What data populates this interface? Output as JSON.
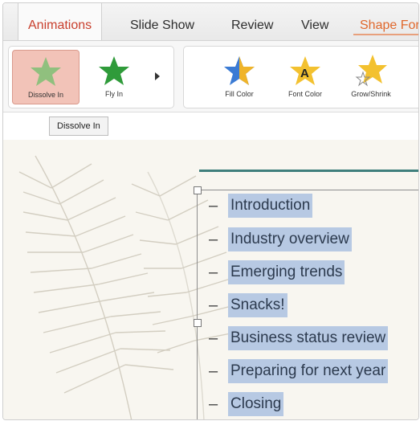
{
  "tabs": [
    {
      "label": "Animations",
      "active": true
    },
    {
      "label": "Slide Show"
    },
    {
      "label": "Review"
    },
    {
      "label": "View"
    },
    {
      "label": "Shape For"
    }
  ],
  "ribbon": {
    "effects": [
      {
        "label": "Dissolve In",
        "icon": "star-dissolve-icon",
        "selected": true
      },
      {
        "label": "Fly In",
        "icon": "star-fly-icon"
      }
    ],
    "emphasis": [
      {
        "label": "Fill Color",
        "icon": "star-fill-color-icon"
      },
      {
        "label": "Font Color",
        "icon": "star-font-color-icon"
      },
      {
        "label": "Grow/Shrink",
        "icon": "star-grow-shrink-icon"
      }
    ]
  },
  "tooltip": "Dissolve In",
  "slide": {
    "items": [
      "Introduction",
      "Industry overview",
      "Emerging trends",
      "Snacks!",
      "Business status review",
      "Preparing for next year",
      "Closing"
    ]
  },
  "colors": {
    "accent": "#c9402e",
    "selection": "#b7c9e3",
    "title_rule": "#3f7f7c"
  }
}
